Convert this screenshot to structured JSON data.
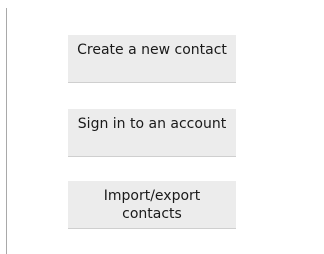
{
  "actions": {
    "create_contact_label": "Create a new contact",
    "sign_in_label": "Sign in to an account",
    "import_export_label": "Import/export contacts"
  },
  "colors": {
    "button_background": "#ececec",
    "button_text": "#1a1a1a",
    "rule": "#a9a9a9"
  }
}
